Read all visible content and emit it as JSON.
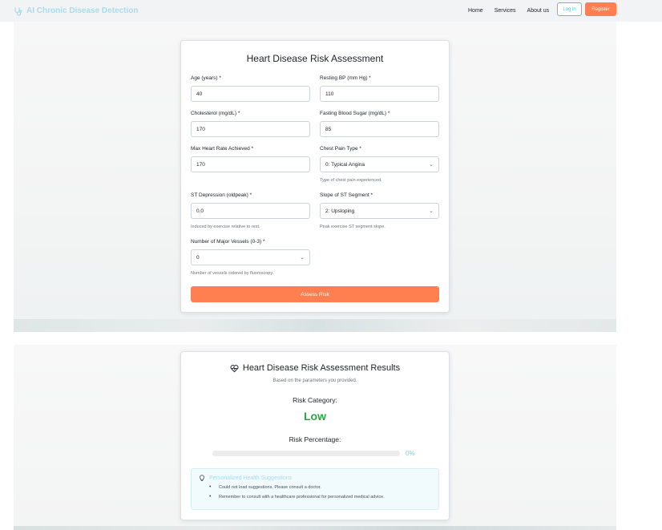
{
  "navbar": {
    "brand": "AI Chronic Disease Detection",
    "brand_color": "#a9dcec",
    "links": [
      "Home",
      "Services",
      "About us"
    ],
    "login_label": "Log in",
    "register_label": "Register",
    "accent": "#ff7f50"
  },
  "form": {
    "title": "Heart Disease Risk Assessment",
    "fields": {
      "age": {
        "label": "Age (years) *",
        "value": "40"
      },
      "resting_bp": {
        "label": "Resting BP (mm Hg) *",
        "value": "110"
      },
      "cholesterol": {
        "label": "Cholesterol (mg/dL) *",
        "value": "170"
      },
      "fasting_sugar": {
        "label": "Fasting Blood Sugar (mg/dL) *",
        "value": "85"
      },
      "max_hr": {
        "label": "Max Heart Rate Achieved *",
        "value": "170"
      },
      "chest_pain": {
        "label": "Chest Pain Type *",
        "value": "0: Typical Angina",
        "help": "Type of chest pain experienced."
      },
      "st_depression": {
        "label": "ST Depression (oldpeak) *",
        "value": "0.0",
        "help": "Induced by exercise relative to rest."
      },
      "slope": {
        "label": "Slope of ST Segment *",
        "value": "2: Upsloping",
        "help": "Peak exercise ST segment slope."
      },
      "vessels": {
        "label": "Number of Major Vessels (0-3) *",
        "value": "0",
        "help": "Number of vessels colored by fluoroscopy."
      }
    },
    "submit_label": "Assess Risk"
  },
  "results": {
    "title": "Heart Disease Risk Assessment Results",
    "subtitle": "Based on the parameters you provided.",
    "risk_category_label": "Risk Category:",
    "risk_category_value": "Low",
    "risk_category_color": "#28a745",
    "risk_percentage_label": "Risk Percentage:",
    "risk_percentage_value": "0%",
    "risk_percentage": 0,
    "suggestions_title": "Personalized Health Suggestions",
    "suggestions": [
      "Could not load suggestions. Please consult a doctor.",
      "Remember to consult with a healthcare professional for personalized medical advice."
    ]
  }
}
